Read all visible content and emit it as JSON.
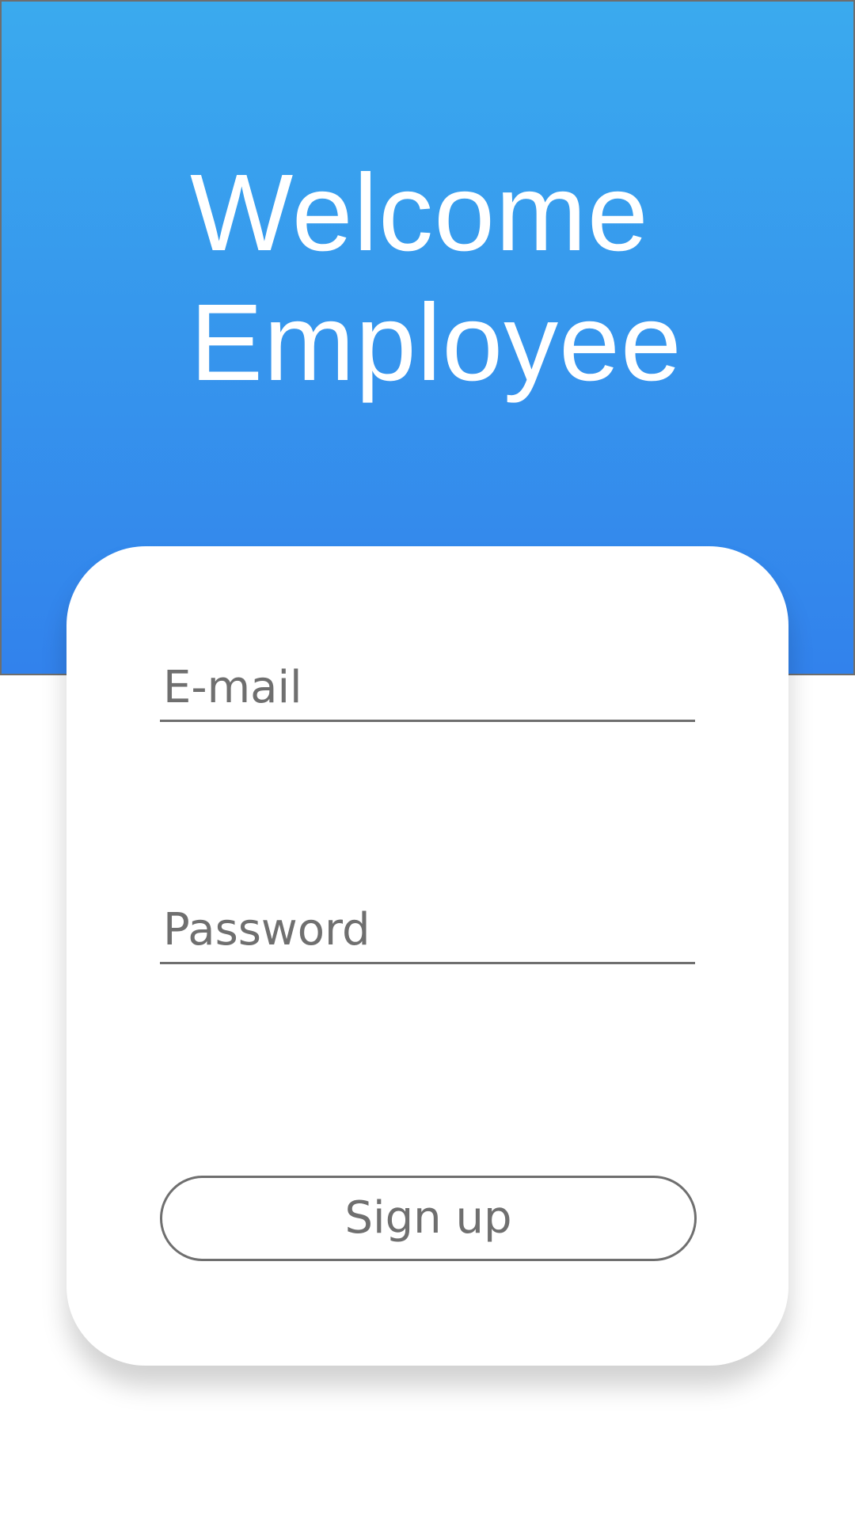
{
  "header": {
    "title_line_1": "Welcome",
    "title_line_2": "Employee"
  },
  "form": {
    "email_placeholder": "E-mail",
    "email_value": "",
    "password_placeholder": "Password",
    "password_value": "",
    "submit_label": "Sign up"
  },
  "colors": {
    "header_gradient_top": "#3aaaee",
    "header_gradient_bottom": "#3282ec",
    "text_gray": "#6f6f6f",
    "card": "#ffffff"
  }
}
